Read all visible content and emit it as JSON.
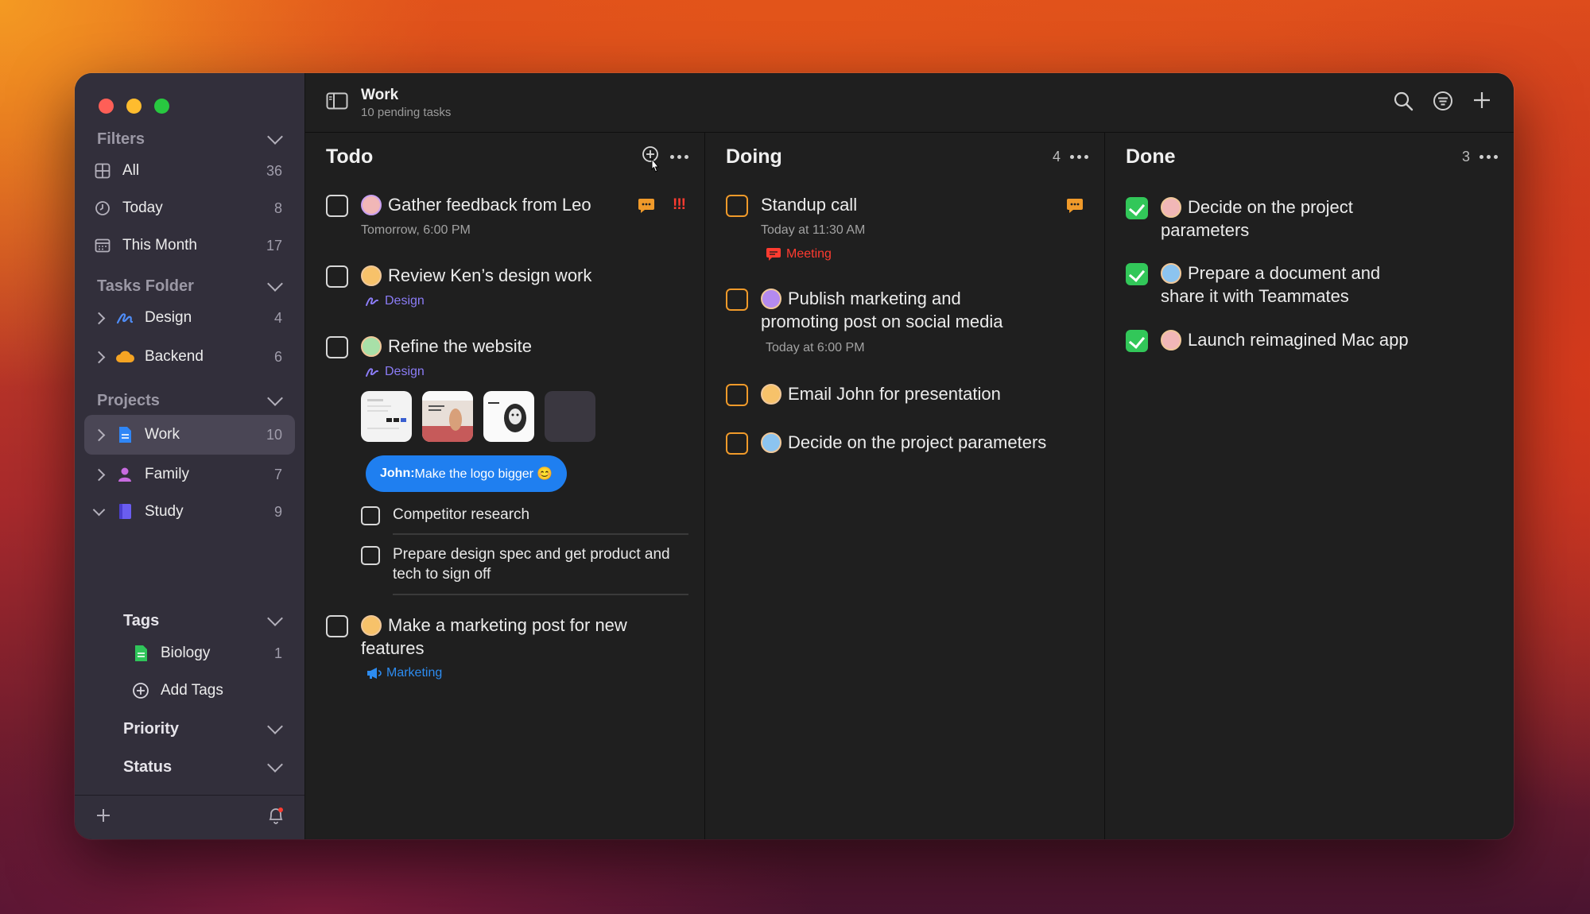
{
  "window": {
    "controls": [
      "close",
      "minimize",
      "zoom"
    ]
  },
  "sidebar": {
    "filters_header": "Filters",
    "filters": [
      {
        "label": "All",
        "count": "36",
        "icon": "grid-icon"
      },
      {
        "label": "Today",
        "count": "8",
        "icon": "clock-icon"
      },
      {
        "label": "This Month",
        "count": "17",
        "icon": "calendar-icon"
      }
    ],
    "folders_header": "Tasks Folder",
    "folders": [
      {
        "label": "Design",
        "count": "4",
        "icon": "pen-icon"
      },
      {
        "label": "Backend",
        "count": "6",
        "icon": "cloud-icon"
      }
    ],
    "projects_header": "Projects",
    "projects": [
      {
        "label": "Work",
        "count": "10",
        "icon": "document-icon",
        "active": true
      },
      {
        "label": "Family",
        "count": "7",
        "icon": "person-icon"
      },
      {
        "label": "Study",
        "count": "9",
        "icon": "book-icon",
        "expanded": true
      }
    ],
    "tags_header": "Tags",
    "tags": [
      {
        "label": "Biology",
        "count": "1",
        "icon": "tag-doc-icon"
      }
    ],
    "add_tags": "Add Tags",
    "priority_header": "Priority",
    "status_header": "Status"
  },
  "header": {
    "title": "Work",
    "subtitle": "10 pending tasks"
  },
  "columns": {
    "todo": {
      "title": "Todo",
      "tasks": [
        {
          "title": "Gather feedback from Leo",
          "meta": "Tomorrow, 6:00 PM",
          "priority": "!!!"
        },
        {
          "title": "Review Ken’s design work",
          "tag": "Design"
        },
        {
          "title": "Refine the website",
          "tag": "Design",
          "comment_author": "John:",
          "comment_text": " Make the logo bigger 😊",
          "subtasks": [
            "Competitor research",
            "Prepare design spec and get product and tech to sign off"
          ]
        },
        {
          "title": "Make a marketing post for new features",
          "tag": "Marketing"
        }
      ]
    },
    "doing": {
      "title": "Doing",
      "count": "4",
      "tasks": [
        {
          "title": "Standup call",
          "meta": "Today at 11:30 AM",
          "tag": "Meeting"
        },
        {
          "title": "Publish marketing and promoting post on social media",
          "meta": "Today at 6:00 PM"
        },
        {
          "title": "Email John for presentation"
        },
        {
          "title": "Decide on the project parameters"
        }
      ]
    },
    "done": {
      "title": "Done",
      "count": "3",
      "tasks": [
        {
          "title": "Decide on the project parameters"
        },
        {
          "title": "Prepare a document and share it with Teammates"
        },
        {
          "title": "Launch reimagined Mac app"
        }
      ]
    }
  },
  "colors": {
    "accent_blue": "#1f7ff0",
    "checkbox_orange": "#f09a2a",
    "done_green": "#32c759",
    "tag_design": "#8b7cf6",
    "tag_meeting": "#ff3b30",
    "tag_marketing": "#2d8cf0",
    "comment_orange": "#f09a2a"
  }
}
